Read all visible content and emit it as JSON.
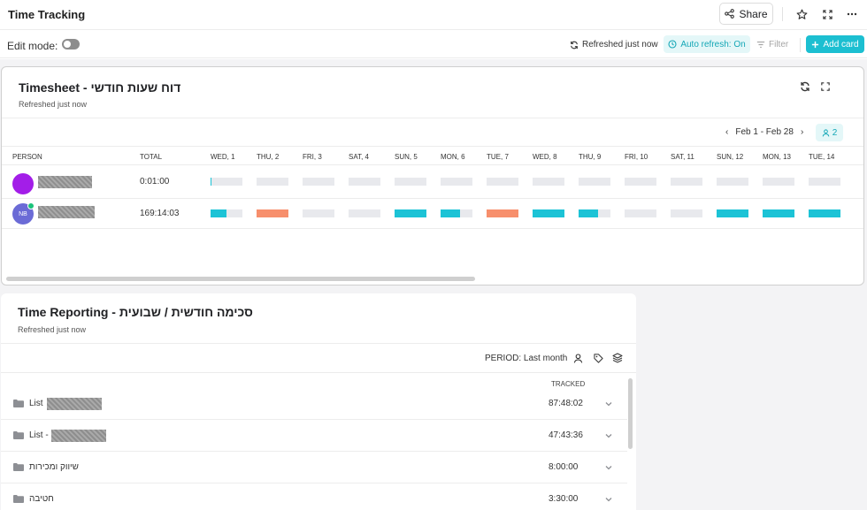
{
  "header": {
    "title": "Time Tracking",
    "share_label": "Share"
  },
  "toolbar": {
    "edit_mode_label": "Edit mode:",
    "edit_mode_on": false,
    "refreshed_label": "Refreshed just now",
    "auto_refresh_label": "Auto refresh: On",
    "filter_label": "Filter",
    "add_card_label": "Add card"
  },
  "timesheet": {
    "title": "Timesheet - דוח שעות חודשי",
    "subtitle": "Refreshed just now",
    "date_range": "Feb 1 - Feb 28",
    "members_count": "2",
    "columns": {
      "person": "PERSON",
      "total": "TOTAL",
      "days": [
        "WED, 1",
        "THU, 2",
        "FRI, 3",
        "SAT, 4",
        "SUN, 5",
        "MON, 6",
        "TUE, 7",
        "WED, 8",
        "THU, 9",
        "FRI, 10",
        "SAT, 11",
        "SUN, 12",
        "MON, 13",
        "TUE, 14"
      ]
    },
    "rows": [
      {
        "avatar_color": "#a31ee8",
        "avatar_initials": "",
        "total": "0:01:00",
        "day_status": [
          {
            "fill": 0.04,
            "color": "#1cc3d6"
          },
          {
            "fill": 0,
            "color": ""
          },
          {
            "fill": 0,
            "color": ""
          },
          {
            "fill": 0,
            "color": ""
          },
          {
            "fill": 0,
            "color": ""
          },
          {
            "fill": 0,
            "color": ""
          },
          {
            "fill": 0,
            "color": ""
          },
          {
            "fill": 0,
            "color": ""
          },
          {
            "fill": 0,
            "color": ""
          },
          {
            "fill": 0,
            "color": ""
          },
          {
            "fill": 0,
            "color": ""
          },
          {
            "fill": 0,
            "color": ""
          },
          {
            "fill": 0,
            "color": ""
          },
          {
            "fill": 0,
            "color": ""
          }
        ]
      },
      {
        "avatar_color": "#6b6bd6",
        "avatar_initials": "NB",
        "total": "169:14:03",
        "day_status": [
          {
            "fill": 0.5,
            "color": "#1cc3d6"
          },
          {
            "fill": 1,
            "color": "#f78f6c"
          },
          {
            "fill": 0,
            "color": ""
          },
          {
            "fill": 0,
            "color": ""
          },
          {
            "fill": 1,
            "color": "#1cc3d6"
          },
          {
            "fill": 0.6,
            "color": "#1cc3d6"
          },
          {
            "fill": 1,
            "color": "#f78f6c"
          },
          {
            "fill": 1,
            "color": "#1cc3d6"
          },
          {
            "fill": 0.6,
            "color": "#1cc3d6"
          },
          {
            "fill": 0,
            "color": ""
          },
          {
            "fill": 0,
            "color": ""
          },
          {
            "fill": 1,
            "color": "#1cc3d6"
          },
          {
            "fill": 1,
            "color": "#1cc3d6"
          },
          {
            "fill": 1,
            "color": "#1cc3d6"
          }
        ]
      }
    ]
  },
  "time_reporting": {
    "title": "Time Reporting - סכימה חודשית / שבועית",
    "subtitle": "Refreshed just now",
    "period_label": "PERIOD: Last month",
    "tracked_header": "TRACKED",
    "rows": [
      {
        "label": "List",
        "redacted": true,
        "tracked": "87:48:02"
      },
      {
        "label": "List -",
        "redacted": true,
        "tracked": "47:43:36"
      },
      {
        "label": "שיווק ומכירות",
        "redacted": false,
        "tracked": "8:00:00"
      },
      {
        "label": "חטיבה",
        "redacted": false,
        "tracked": "3:30:00"
      }
    ]
  },
  "colors": {
    "accent": "#1cbfd1",
    "accent_light": "#e4f7f8",
    "overtime": "#f78f6c",
    "empty_cell": "#e8e9ed"
  },
  "icons": [
    "share-icon",
    "star-icon",
    "expand-icon",
    "more-icon",
    "refresh-icon",
    "clock-icon",
    "filter-icon",
    "plus-icon",
    "folder-icon",
    "chevron-down-icon",
    "person-icon",
    "tag-icon",
    "layers-icon"
  ]
}
